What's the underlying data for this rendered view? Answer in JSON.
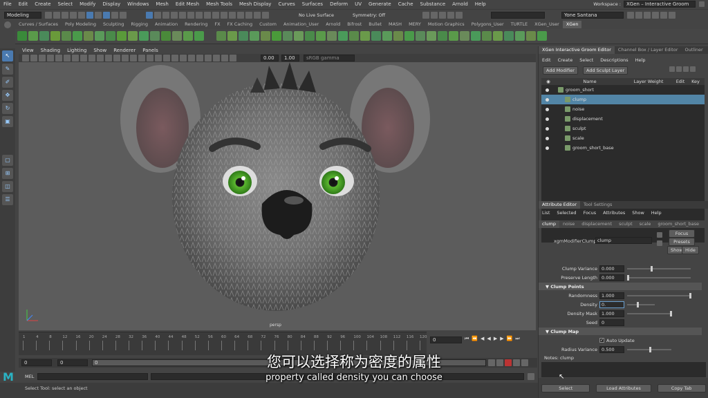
{
  "menubar": {
    "items": [
      "File",
      "Edit",
      "Create",
      "Select",
      "Modify",
      "Display",
      "Windows",
      "Mesh",
      "Edit Mesh",
      "Mesh Tools",
      "Mesh Display",
      "Curves",
      "Surfaces",
      "Deform",
      "UV",
      "Generate",
      "Cache",
      "Substance",
      "Arnold",
      "Help"
    ],
    "workspace_label": "Workspace :",
    "workspace_value": "XGen – Interactive Groom"
  },
  "statusline": {
    "mode": "Modeling",
    "live_surface": "No Live Surface",
    "symmetry": "Symmetry: Off",
    "user": "Yone Santana"
  },
  "shelf": {
    "tabs": [
      "Curves / Surfaces",
      "Poly Modeling",
      "Sculpting",
      "Rigging",
      "Animation",
      "Rendering",
      "FX",
      "FX Caching",
      "Custom",
      "Animation_User",
      "Arnold",
      "Bifrost",
      "Bullet",
      "MASH",
      "MERY",
      "Motion Graphics",
      "Polygons_User",
      "TURTLE",
      "XGen_User",
      "XGen"
    ],
    "active_tab": "XGen"
  },
  "viewport": {
    "menu": [
      "View",
      "Shading",
      "Lighting",
      "Show",
      "Renderer",
      "Panels"
    ],
    "camera_label": "persp",
    "field_a": "0.00",
    "field_b": "1.00",
    "color_space": "sRGB gamma"
  },
  "timeline": {
    "ticks": [
      "1",
      "4",
      "8",
      "12",
      "16",
      "20",
      "24",
      "28",
      "32",
      "36",
      "40",
      "44",
      "48",
      "52",
      "56",
      "60",
      "64",
      "68",
      "72",
      "76",
      "80",
      "84",
      "88",
      "92",
      "96",
      "100",
      "104",
      "108",
      "112",
      "116",
      "120"
    ],
    "current_frame": "0",
    "start_field": "0",
    "end_field": "0",
    "range_start": "0",
    "range_end": "0"
  },
  "mel": {
    "label": "MEL",
    "help_text": "Select Tool: select an object"
  },
  "subtitles": {
    "chinese": "您可以选择称为密度的属性",
    "english": "property called density you can choose"
  },
  "right_panel": {
    "top_tabs": [
      "XGen Interactive Groom Editor",
      "Channel Box / Layer Editor",
      "Outliner"
    ],
    "top_menu": [
      "Edit",
      "Create",
      "Select",
      "Descriptions",
      "Help"
    ],
    "add_modifier": "Add Modifier",
    "add_sculpt_layer": "Add Sculpt Layer",
    "outliner_headers": {
      "name": "Name",
      "layer_weight": "Layer Weight",
      "edit": "Edit",
      "key": "Key"
    },
    "outliner_rows": [
      {
        "label": "groom_short",
        "indent": 0,
        "selected": false
      },
      {
        "label": "clump",
        "indent": 1,
        "selected": true
      },
      {
        "label": "noise",
        "indent": 1,
        "selected": false
      },
      {
        "label": "displacement",
        "indent": 1,
        "selected": false
      },
      {
        "label": "sculpt",
        "indent": 1,
        "selected": false
      },
      {
        "label": "scale",
        "indent": 1,
        "selected": false
      },
      {
        "label": "groom_short_base",
        "indent": 1,
        "selected": false
      }
    ],
    "attr_tabs": [
      "Attribute Editor",
      "Tool Settings"
    ],
    "attr_menu": [
      "List",
      "Selected",
      "Focus",
      "Attributes",
      "Show",
      "Help"
    ],
    "node_tabs": [
      "clump",
      "noise",
      "displacement",
      "sculpt",
      "scale",
      "groom_short_base"
    ],
    "node_type_label": "xgmModifierClump:",
    "node_name": "clump",
    "focus_btn": "Focus",
    "presets_btn": "Presets",
    "show_btn": "Show",
    "hide_btn": "Hide",
    "attrs_top": [
      {
        "label": "Clump Variance",
        "value": "0.000"
      },
      {
        "label": "Preserve Length",
        "value": "0.000"
      }
    ],
    "section_clump_points": "Clump Points",
    "attrs_points": [
      {
        "label": "Randomness",
        "value": "1.000"
      },
      {
        "label": "Density",
        "value": "0."
      },
      {
        "label": "Density Mask",
        "value": "1.000"
      },
      {
        "label": "Seed",
        "value": "0"
      }
    ],
    "section_clump_map": "Clump Map",
    "auto_update": "Auto Update",
    "radius_variance_label": "Radius Variance",
    "radius_variance_value": "0.500",
    "notes_label": "Notes: clump",
    "select_btn": "Select",
    "load_attributes_btn": "Load Attributes",
    "copy_tab_btn": "Copy Tab"
  },
  "colors": {
    "selection_blue": "#5285a6",
    "ui_bg": "#444444",
    "viewport_bg": "#5c5c5c"
  }
}
